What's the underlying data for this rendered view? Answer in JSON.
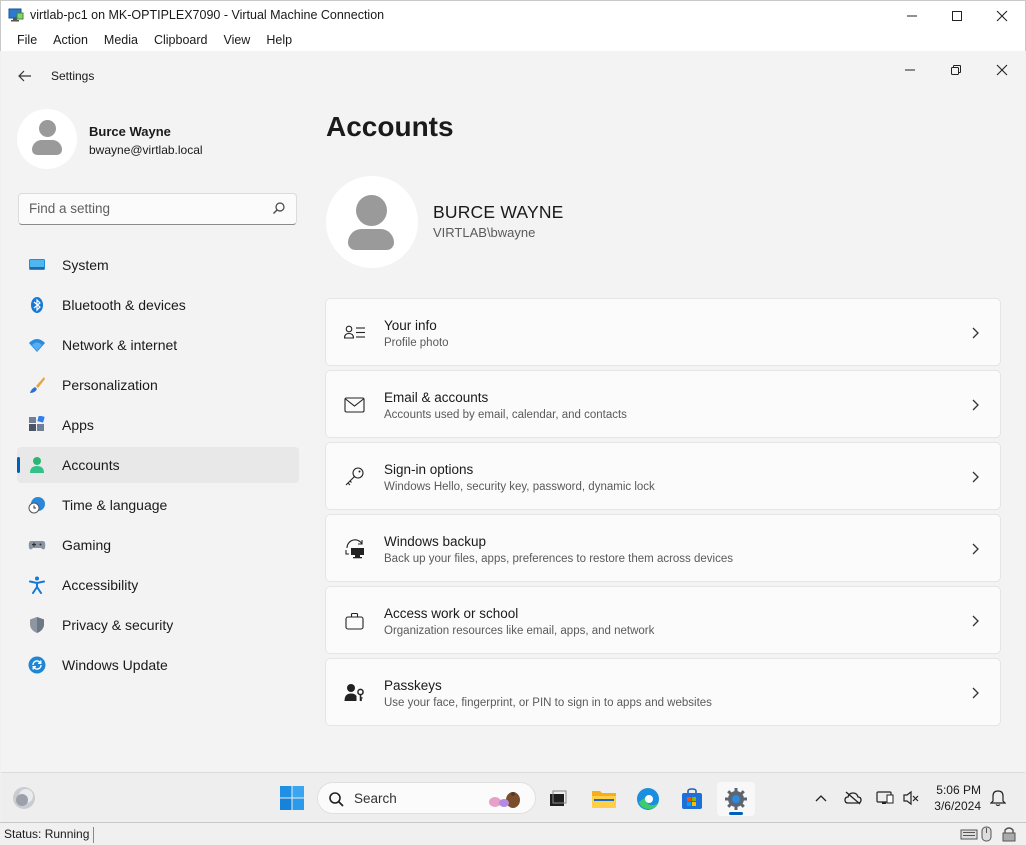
{
  "vm": {
    "title": "virtlab-pc1 on MK-OPTIPLEX7090 - Virtual Machine Connection",
    "menu": [
      "File",
      "Action",
      "Media",
      "Clipboard",
      "View",
      "Help"
    ],
    "status": "Status: Running"
  },
  "settings": {
    "window_title": "Settings",
    "user": {
      "name": "Burce Wayne",
      "email": "bwayne@virtlab.local"
    },
    "search": {
      "placeholder": "Find a setting"
    },
    "nav": [
      {
        "label": "System",
        "icon": "system-icon"
      },
      {
        "label": "Bluetooth & devices",
        "icon": "bluetooth-icon"
      },
      {
        "label": "Network & internet",
        "icon": "wifi-icon"
      },
      {
        "label": "Personalization",
        "icon": "brush-icon"
      },
      {
        "label": "Apps",
        "icon": "apps-icon"
      },
      {
        "label": "Accounts",
        "icon": "accounts-icon",
        "active": true
      },
      {
        "label": "Time & language",
        "icon": "globe-clock-icon"
      },
      {
        "label": "Gaming",
        "icon": "gamepad-icon"
      },
      {
        "label": "Accessibility",
        "icon": "accessibility-icon"
      },
      {
        "label": "Privacy & security",
        "icon": "shield-icon"
      },
      {
        "label": "Windows Update",
        "icon": "update-icon"
      }
    ],
    "page_title": "Accounts",
    "account": {
      "display_name": "BURCE WAYNE",
      "domain_user": "VIRTLAB\\bwayne"
    },
    "cards": [
      {
        "title": "Your info",
        "subtitle": "Profile photo",
        "icon": "person-info-icon"
      },
      {
        "title": "Email & accounts",
        "subtitle": "Accounts used by email, calendar, and contacts",
        "icon": "mail-icon"
      },
      {
        "title": "Sign-in options",
        "subtitle": "Windows Hello, security key, password, dynamic lock",
        "icon": "key-icon"
      },
      {
        "title": "Windows backup",
        "subtitle": "Back up your files, apps, preferences to restore them across devices",
        "icon": "backup-icon"
      },
      {
        "title": "Access work or school",
        "subtitle": "Organization resources like email, apps, and network",
        "icon": "briefcase-icon"
      },
      {
        "title": "Passkeys",
        "subtitle": "Use your face, fingerprint, or PIN to sign in to apps and websites",
        "icon": "passkey-icon"
      }
    ]
  },
  "taskbar": {
    "search_label": "Search",
    "time": "5:06 PM",
    "date": "3/6/2024"
  },
  "colors": {
    "accent": "#005fb8"
  }
}
